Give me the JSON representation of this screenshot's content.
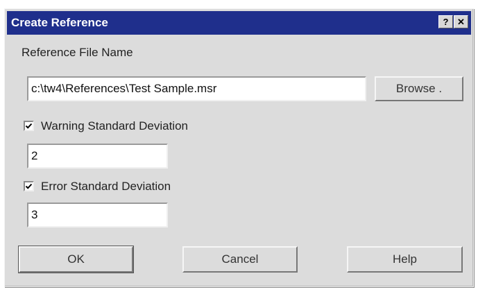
{
  "dialog": {
    "title": "Create Reference",
    "help_glyph": "?",
    "close_glyph": "✕"
  },
  "reference": {
    "label": "Reference File Name",
    "file_value": "c:\\tw4\\References\\Test Sample.msr",
    "browse_label": "Browse ."
  },
  "warning": {
    "checked": true,
    "label": "Warning Standard Deviation",
    "value": "2"
  },
  "error": {
    "checked": true,
    "label": "Error Standard Deviation",
    "value": "3"
  },
  "buttons": {
    "ok": "OK",
    "cancel": "Cancel",
    "help": "Help"
  },
  "colors": {
    "titlebar": "#1f2f8c",
    "dialog_bg": "#dcdcdc"
  },
  "icons": [
    "help-icon",
    "close-icon",
    "checkmark-icon"
  ]
}
